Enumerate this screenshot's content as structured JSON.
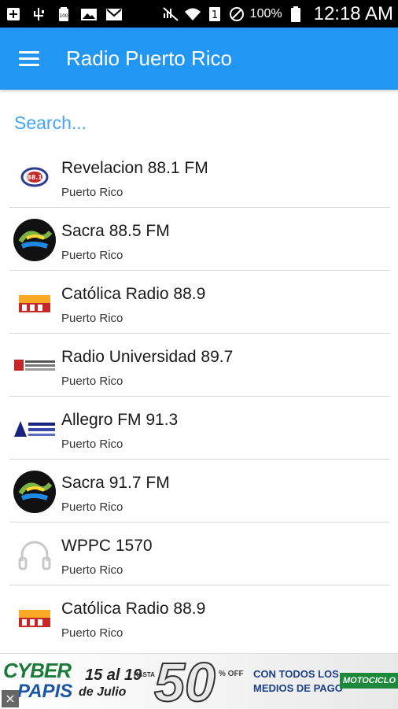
{
  "status_bar": {
    "battery_percent": "100%",
    "sim_label": "1",
    "time": "12:18 AM",
    "icons": [
      "add-icon",
      "usb-icon",
      "battery-small-icon",
      "image-icon",
      "gmail-icon",
      "mute-icon",
      "wifi-icon",
      "sim-icon",
      "blocked-icon",
      "battery-icon"
    ]
  },
  "app_bar": {
    "title": "Radio Puerto Rico",
    "color": "#2196f3"
  },
  "search": {
    "placeholder": "Search..."
  },
  "stations": [
    {
      "name": "Revelacion 88.1 FM",
      "location": "Puerto Rico",
      "logo": "revelacion-logo"
    },
    {
      "name": "Sacra 88.5 FM",
      "location": "Puerto Rico",
      "logo": "sacra-logo"
    },
    {
      "name": "Católica Radio 88.9",
      "location": "Puerto Rico",
      "logo": "catolica-logo"
    },
    {
      "name": "Radio Universidad 89.7",
      "location": "Puerto Rico",
      "logo": "universidad-logo"
    },
    {
      "name": "Allegro FM 91.3",
      "location": "Puerto Rico",
      "logo": "allegro-logo"
    },
    {
      "name": "Sacra 91.7 FM",
      "location": "Puerto Rico",
      "logo": "sacra-logo"
    },
    {
      "name": "WPPC 1570",
      "location": "Puerto Rico",
      "logo": "headphones-icon"
    },
    {
      "name": "Católica Radio 88.9",
      "location": "Puerto Rico",
      "logo": "catolica-logo"
    }
  ],
  "ad": {
    "close": "×",
    "brand_top": "CYBER",
    "brand_bottom": "PAPIS",
    "dates": "15 al 19",
    "month": "de Julio",
    "until": "HASTA",
    "percent": "50",
    "off": "% OFF",
    "line1": "CON TODOS LOS",
    "line2": "MEDIOS DE PAGO",
    "store": "MOTOCICLO"
  }
}
